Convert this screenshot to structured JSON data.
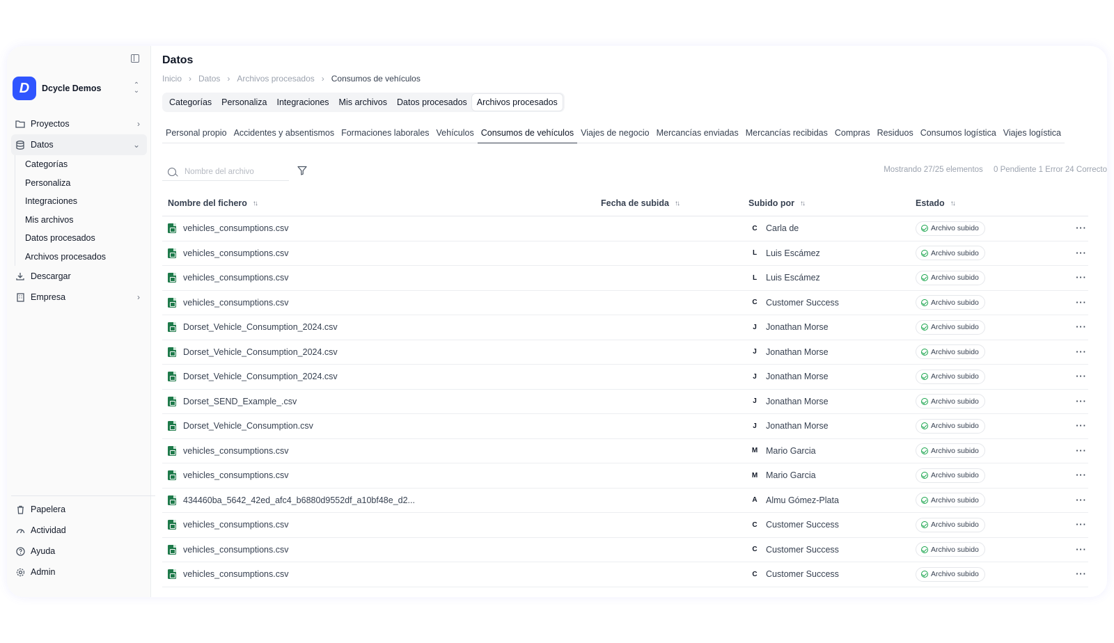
{
  "sidebar": {
    "workspace_name": "Dcycle Demos",
    "nav": [
      {
        "label": "Proyectos",
        "icon": "folder-icon",
        "expandable": true
      },
      {
        "label": "Datos",
        "icon": "database-icon",
        "expandable": true,
        "expanded": true
      },
      {
        "label": "Descargar",
        "icon": "download-icon"
      },
      {
        "label": "Empresa",
        "icon": "building-icon",
        "expandable": true
      }
    ],
    "sub_items": [
      "Categorías",
      "Personaliza",
      "Integraciones",
      "Mis archivos",
      "Datos procesados",
      "Archivos procesados"
    ],
    "bottom": [
      {
        "label": "Papelera",
        "icon": "trash-icon"
      },
      {
        "label": "Actividad",
        "icon": "activity-icon"
      },
      {
        "label": "Ayuda",
        "icon": "help-icon"
      },
      {
        "label": "Admin",
        "icon": "gear-icon"
      }
    ]
  },
  "header": {
    "title": "Datos",
    "breadcrumb": [
      "Inicio",
      "Datos",
      "Archivos procesados",
      "Consumos de vehículos"
    ]
  },
  "tabs": [
    "Categorías",
    "Personaliza",
    "Integraciones",
    "Mis archivos",
    "Datos procesados",
    "Archivos procesados"
  ],
  "active_tab": "Archivos procesados",
  "subtabs": [
    "Personal propio",
    "Accidentes y absentismos",
    "Formaciones laborales",
    "Vehículos",
    "Consumos de vehículos",
    "Viajes de negocio",
    "Mercancías enviadas",
    "Mercancías recibidas",
    "Compras",
    "Residuos",
    "Consumos logística",
    "Viajes logística"
  ],
  "active_subtab": "Consumos de vehículos",
  "search": {
    "placeholder": "Nombre del archivo",
    "value": ""
  },
  "summary": {
    "showing": "Mostrando 27/25 elementos",
    "status": "0 Pendiente 1 Error 24 Correcto"
  },
  "table": {
    "columns": [
      "Nombre del fichero",
      "Fecha de subida",
      "Subido por",
      "Estado"
    ],
    "rows": [
      {
        "name": "vehicles_consumptions.csv",
        "date": "",
        "initial": "C",
        "user": "Carla de",
        "status": "Archivo subido"
      },
      {
        "name": "vehicles_consumptions.csv",
        "date": "",
        "initial": "L",
        "user": "Luis Escámez",
        "status": "Archivo subido"
      },
      {
        "name": "vehicles_consumptions.csv",
        "date": "",
        "initial": "L",
        "user": "Luis Escámez",
        "status": "Archivo subido"
      },
      {
        "name": "vehicles_consumptions.csv",
        "date": "",
        "initial": "C",
        "user": "Customer Success",
        "status": "Archivo subido"
      },
      {
        "name": "Dorset_Vehicle_Consumption_2024.csv",
        "date": "",
        "initial": "J",
        "user": "Jonathan Morse",
        "status": "Archivo subido"
      },
      {
        "name": "Dorset_Vehicle_Consumption_2024.csv",
        "date": "",
        "initial": "J",
        "user": "Jonathan Morse",
        "status": "Archivo subido"
      },
      {
        "name": "Dorset_Vehicle_Consumption_2024.csv",
        "date": "",
        "initial": "J",
        "user": "Jonathan Morse",
        "status": "Archivo subido"
      },
      {
        "name": "Dorset_SEND_Example_.csv",
        "date": "",
        "initial": "J",
        "user": "Jonathan Morse",
        "status": "Archivo subido"
      },
      {
        "name": "Dorset_Vehicle_Consumption.csv",
        "date": "",
        "initial": "J",
        "user": "Jonathan Morse",
        "status": "Archivo subido"
      },
      {
        "name": "vehicles_consumptions.csv",
        "date": "",
        "initial": "M",
        "user": "Mario Garcia",
        "status": "Archivo subido"
      },
      {
        "name": "vehicles_consumptions.csv",
        "date": "",
        "initial": "M",
        "user": "Mario Garcia",
        "status": "Archivo subido"
      },
      {
        "name": "434460ba_5642_42ed_afc4_b6880d9552df_a10bf48e_d2...",
        "date": "",
        "initial": "A",
        "user": "Almu Gómez-Plata",
        "status": "Archivo subido"
      },
      {
        "name": "vehicles_consumptions.csv",
        "date": "",
        "initial": "C",
        "user": "Customer Success",
        "status": "Archivo subido"
      },
      {
        "name": "vehicles_consumptions.csv",
        "date": "",
        "initial": "C",
        "user": "Customer Success",
        "status": "Archivo subido"
      },
      {
        "name": "vehicles_consumptions.csv",
        "date": "",
        "initial": "C",
        "user": "Customer Success",
        "status": "Archivo subido"
      }
    ]
  },
  "colors": {
    "brand": "#2f55ff",
    "success": "#16a34a",
    "file": "#1e7a4a"
  }
}
